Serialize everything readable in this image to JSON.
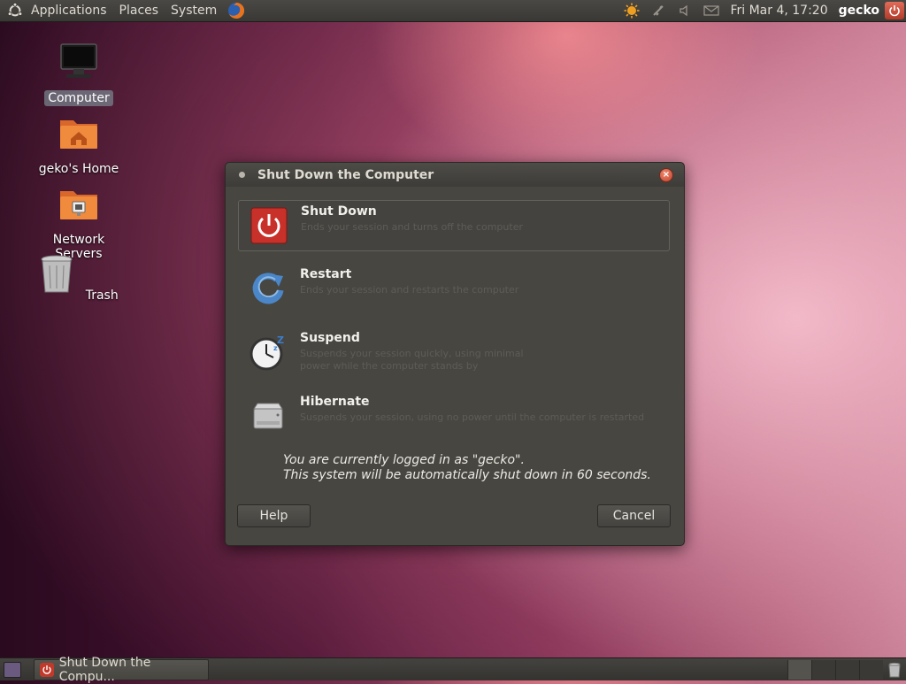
{
  "top_panel": {
    "menus": [
      "Applications",
      "Places",
      "System"
    ],
    "clock": "Fri Mar  4, 17:20",
    "username": "gecko"
  },
  "desktop": {
    "icons": [
      {
        "label": "Computer",
        "icon": "computer-icon",
        "selected": true
      },
      {
        "label": "geko's Home",
        "icon": "home-folder-icon"
      },
      {
        "label": "Network Servers",
        "icon": "network-folder-icon"
      },
      {
        "label": "Trash",
        "icon": "trash-icon"
      }
    ]
  },
  "dialog": {
    "title": "Shut Down the Computer",
    "options": [
      {
        "title": "Shut Down",
        "description": "Ends your session and turns off the computer",
        "icon": "power-icon",
        "selected": true
      },
      {
        "title": "Restart",
        "description": "Ends your session and restarts the computer",
        "icon": "restart-icon"
      },
      {
        "title": "Suspend",
        "description": "Suspends your session quickly, using minimal power while the computer stands by",
        "icon": "clock-icon"
      },
      {
        "title": "Hibernate",
        "description": "Suspends your session, using no power until the computer is restarted",
        "icon": "hard-drive-icon"
      }
    ],
    "status_line1": "You are currently logged in as \"gecko\".",
    "status_line2": "This system will be automatically shut down in 60 seconds.",
    "help_label": "Help",
    "cancel_label": "Cancel"
  },
  "bottom_panel": {
    "task_label": "Shut Down the Compu..."
  },
  "colors": {
    "dialog_bg": "#474641",
    "panel_bg": "#3a3835",
    "accent_power": "#c0392b"
  }
}
